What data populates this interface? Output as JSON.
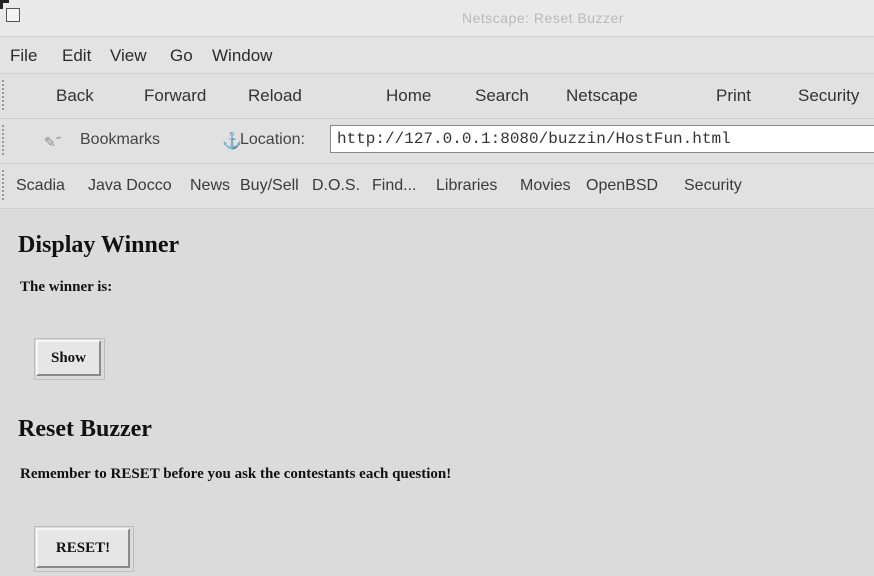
{
  "window": {
    "title": "Netscape: Reset Buzzer"
  },
  "menubar": {
    "items": [
      "File",
      "Edit",
      "View",
      "Go",
      "Window"
    ]
  },
  "navbar": {
    "buttons": [
      "Back",
      "Forward",
      "Reload",
      "Home",
      "Search",
      "Netscape",
      "Print",
      "Security"
    ]
  },
  "locationbar": {
    "bookmarks_label": "Bookmarks",
    "location_label": "Location:",
    "url": "http://127.0.0.1:8080/buzzin/HostFun.html"
  },
  "personal_toolbar": {
    "items": [
      "Scadia",
      "Java Docco",
      "News",
      "Buy/Sell",
      "D.O.S.",
      "Find...",
      "Libraries",
      "Movies",
      "OpenBSD",
      "Security"
    ]
  },
  "page": {
    "display_heading": "Display Winner",
    "winner_text": "The winner is:",
    "show_button": "Show",
    "reset_heading": "Reset Buzzer",
    "reset_note": "Remember to RESET before you ask the contestants each question!",
    "reset_button": "RESET!"
  },
  "colors": {
    "chrome": "#e1e1e1",
    "content_bg": "#dbdbdb",
    "title_text": "#b9b9b9"
  },
  "icons": {
    "window_close": "window-box-icon",
    "bookmarks": "bookmarks-icon",
    "location": "location-icon"
  }
}
